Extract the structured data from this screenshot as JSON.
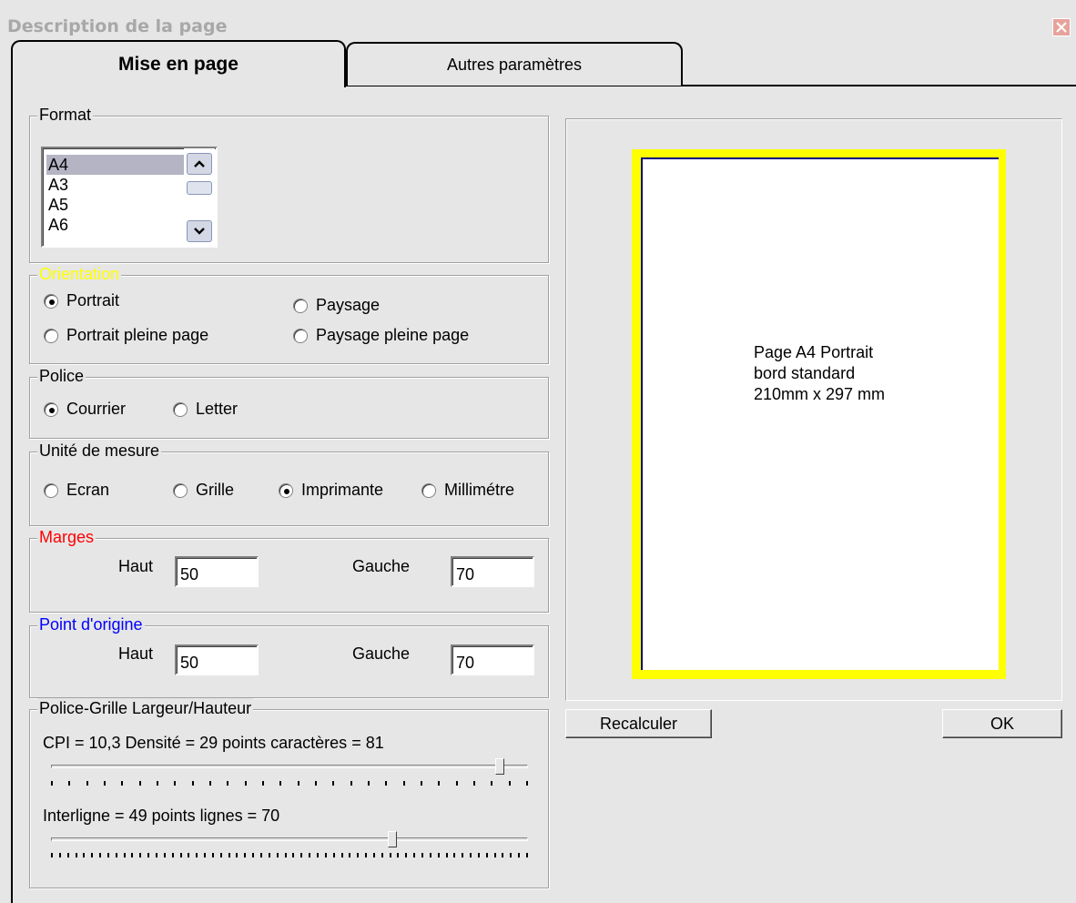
{
  "window": {
    "title": "Description de la page"
  },
  "tabs": [
    {
      "label": "Mise en page",
      "active": true
    },
    {
      "label": "Autres paramètres",
      "active": false
    }
  ],
  "format": {
    "legend": "Format",
    "items": [
      "A4",
      "A3",
      "A5",
      "A6"
    ],
    "selected": "A4"
  },
  "orientation": {
    "legend": "Orientation",
    "legend_color": "#ffff00",
    "options": [
      "Portrait",
      "Paysage",
      "Portrait pleine page",
      "Paysage pleine page"
    ],
    "selected": "Portrait"
  },
  "police": {
    "legend": "Police",
    "options": [
      "Courrier",
      "Letter"
    ],
    "selected": "Courrier"
  },
  "unite": {
    "legend": "Unité de mesure",
    "options": [
      "Ecran",
      "Grille",
      "Imprimante",
      "Millimétre"
    ],
    "selected": "Imprimante"
  },
  "marges": {
    "legend": "Marges",
    "legend_color": "#ff0000",
    "haut_label": "Haut",
    "haut_value": "50",
    "gauche_label": "Gauche",
    "gauche_value": "70"
  },
  "origine": {
    "legend": "Point d'origine",
    "legend_color": "#0000ff",
    "haut_label": "Haut",
    "haut_value": "50",
    "gauche_label": "Gauche",
    "gauche_value": "70"
  },
  "police_grille": {
    "legend": "Police-Grille  Largeur/Hauteur",
    "cpi_text": "CPI = 10,3 Densité = 29 points caractères = 81",
    "cpi_slider_fraction": 0.95,
    "interligne_text": "Interligne = 49 points lignes = 70",
    "interligne_slider_fraction": 0.72
  },
  "preview": {
    "line1": "Page A4 Portrait",
    "line2": "bord standard",
    "line3": "210mm x 297 mm",
    "border_color": "#ffff00"
  },
  "buttons": {
    "recalculer": "Recalculer",
    "ok": "OK"
  }
}
